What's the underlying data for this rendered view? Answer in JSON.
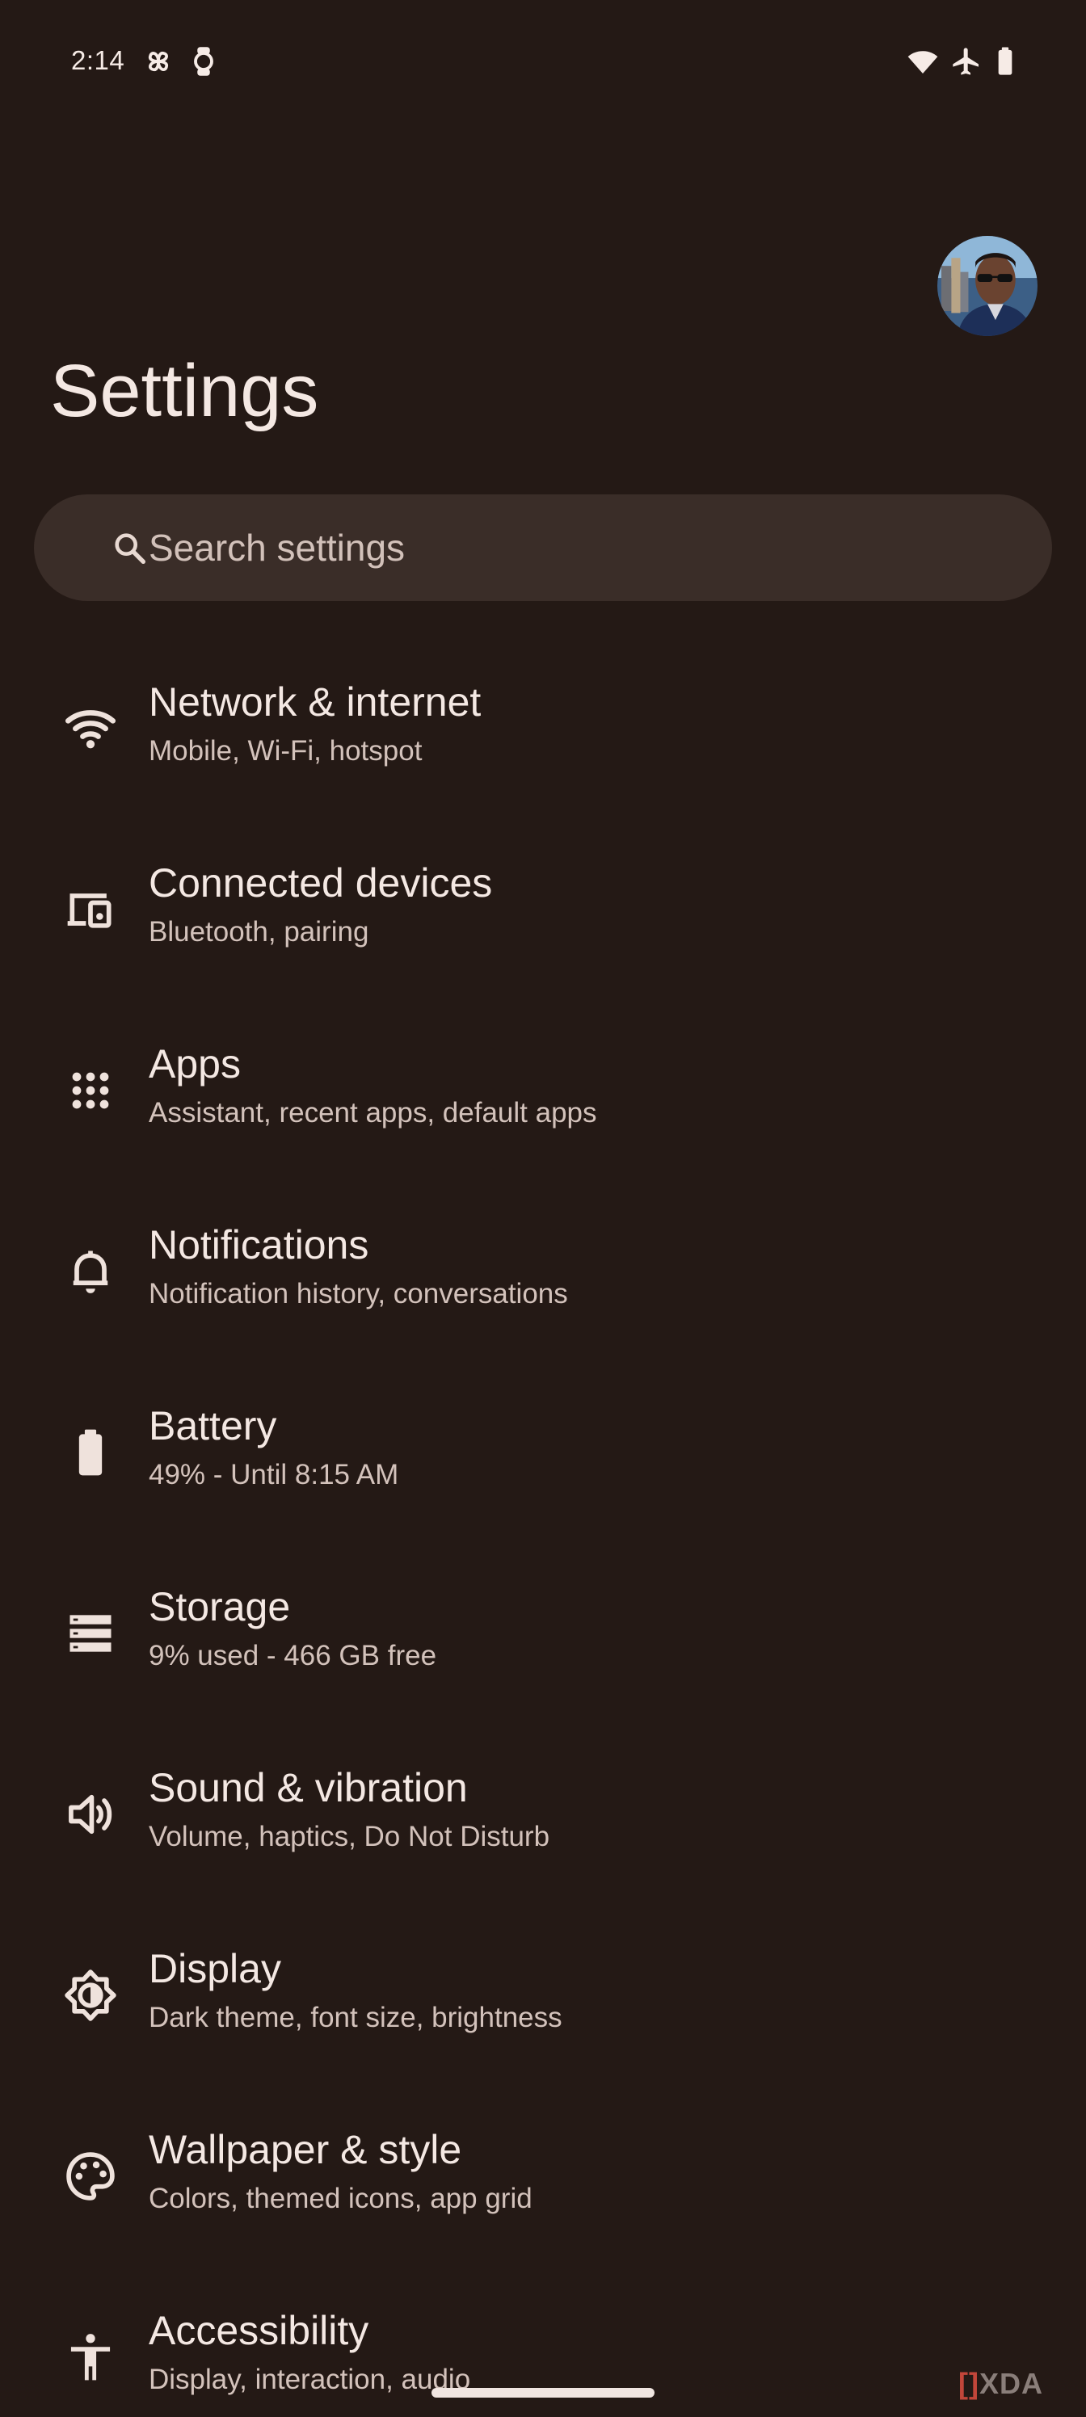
{
  "status_bar": {
    "time": "2:14",
    "left_icons": [
      "pinwheel-icon",
      "watch-icon"
    ],
    "right_icons": [
      "wifi-icon",
      "airplane-mode-icon",
      "battery-icon"
    ]
  },
  "header": {
    "title": "Settings",
    "avatar": "profile-avatar"
  },
  "search": {
    "placeholder": "Search settings",
    "value": ""
  },
  "settings": [
    {
      "icon": "wifi-icon",
      "title": "Network & internet",
      "subtitle": "Mobile, Wi-Fi, hotspot"
    },
    {
      "icon": "devices-icon",
      "title": "Connected devices",
      "subtitle": "Bluetooth, pairing"
    },
    {
      "icon": "apps-grid-icon",
      "title": "Apps",
      "subtitle": "Assistant, recent apps, default apps"
    },
    {
      "icon": "bell-icon",
      "title": "Notifications",
      "subtitle": "Notification history, conversations"
    },
    {
      "icon": "battery-icon",
      "title": "Battery",
      "subtitle": "49% - Until 8:15 AM"
    },
    {
      "icon": "storage-icon",
      "title": "Storage",
      "subtitle": "9% used - 466 GB free"
    },
    {
      "icon": "speaker-icon",
      "title": "Sound & vibration",
      "subtitle": "Volume, haptics, Do Not Disturb"
    },
    {
      "icon": "brightness-icon",
      "title": "Display",
      "subtitle": "Dark theme, font size, brightness"
    },
    {
      "icon": "palette-icon",
      "title": "Wallpaper & style",
      "subtitle": "Colors, themed icons, app grid"
    },
    {
      "icon": "accessibility-icon",
      "title": "Accessibility",
      "subtitle": "Display, interaction, audio"
    }
  ],
  "watermark": {
    "bracket": "[]",
    "text": "XDA"
  },
  "colors": {
    "background": "#241915",
    "search_background": "#3a2d28",
    "primary_text": "#f4e8e3",
    "secondary_text": "#d3c2bb"
  }
}
